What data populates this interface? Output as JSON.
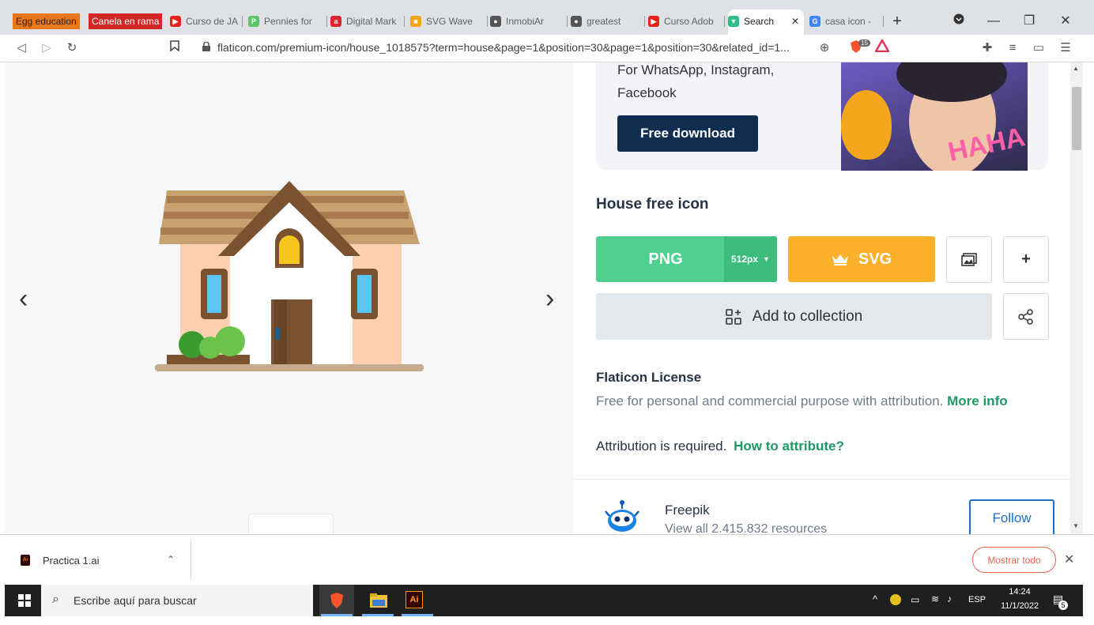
{
  "tabs": {
    "bookmark_1": "Egg education",
    "bookmark_2": "Canela en rama",
    "items": [
      {
        "label": "Curso de JA",
        "color": "#e62117",
        "glyph": "▶"
      },
      {
        "label": "Pennies for",
        "color": "#5cc46b",
        "glyph": "P"
      },
      {
        "label": "Digital Mark",
        "color": "#d9252f",
        "glyph": "a"
      },
      {
        "label": "SVG Wave",
        "color": "#f2a51b",
        "glyph": "■"
      },
      {
        "label": "InmobiAr",
        "color": "#555555",
        "glyph": "●"
      },
      {
        "label": "greatest",
        "color": "#555555",
        "glyph": "●"
      },
      {
        "label": "Curso Adob",
        "color": "#e62117",
        "glyph": "▶"
      },
      {
        "label": "Search",
        "color": "#2dbf86",
        "glyph": "▼"
      },
      {
        "label": "casa icon -",
        "color": "#4285f4",
        "glyph": "G"
      }
    ],
    "new_tab": "+"
  },
  "toolbar": {
    "url": "flaticon.com/premium-icon/house_1018575?term=house&page=1&position=30&page=1&position=30&related_id=1...",
    "shield_count": "15"
  },
  "promo": {
    "line1": "For WhatsApp, Instagram,",
    "line2": "Facebook",
    "download_label": "Free download",
    "sticker_text": "HAHA"
  },
  "icon_detail": {
    "title": "House free icon",
    "png_label": "PNG",
    "size_label": "512px",
    "svg_label": "SVG",
    "add_collection_label": "Add to collection",
    "plus_label": "+"
  },
  "license": {
    "title": "Flaticon License",
    "text": "Free for personal and commercial purpose with attribution.",
    "more_info": "More info",
    "attribution": "Attribution is required.",
    "how_to": "How to attribute?"
  },
  "author": {
    "name": "Freepik",
    "resources": "View all 2.415.832 resources",
    "follow_label": "Follow"
  },
  "downloads": {
    "file_name": "Practica 1.ai",
    "show_all": "Mostrar todo"
  },
  "taskbar": {
    "search_placeholder": "Escribe aquí para buscar",
    "ai_label": "Ai",
    "language": "ESP",
    "time": "14:24",
    "date": "11/1/2022",
    "notifications": "5"
  },
  "colors": {
    "png_green": "#4fd08e",
    "svg_orange": "#fbb12e",
    "navy": "#0f2d4f",
    "link_green": "#1d9a64",
    "follow_blue": "#1a6fc9"
  }
}
